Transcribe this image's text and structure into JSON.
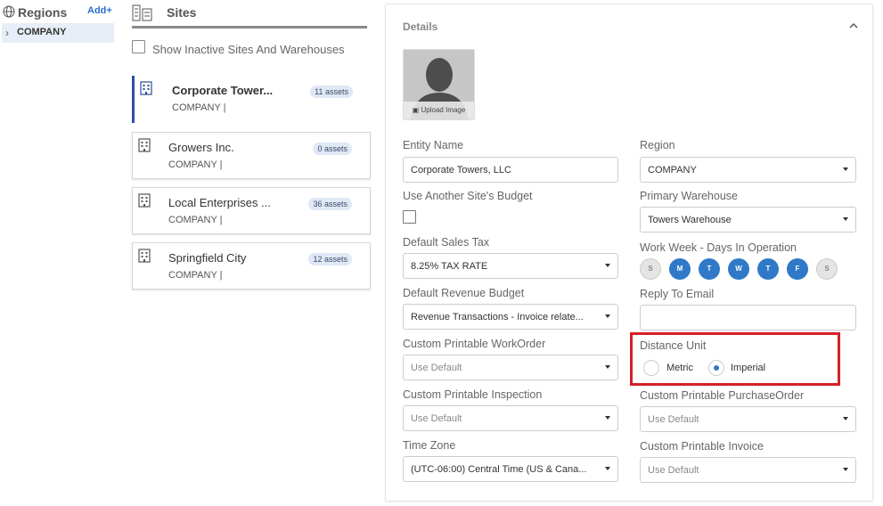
{
  "regions": {
    "title": "Regions",
    "add_label": "Add+",
    "items": [
      {
        "label": "COMPANY",
        "chevron": "›"
      }
    ]
  },
  "sites": {
    "title": "Sites",
    "show_inactive_label": "Show Inactive Sites And Warehouses",
    "cards": [
      {
        "name": "Corporate Tower...",
        "sub": "COMPANY |",
        "badge": "11 assets",
        "selected": true
      },
      {
        "name": "Growers Inc.",
        "sub": "COMPANY |",
        "badge": "0 assets",
        "selected": false
      },
      {
        "name": "Local Enterprises ...",
        "sub": "COMPANY |",
        "badge": "36 assets",
        "selected": false
      },
      {
        "name": "Springfield City",
        "sub": "COMPANY |",
        "badge": "12 assets",
        "selected": false
      }
    ]
  },
  "details": {
    "title": "Details",
    "collapse_icon": "chevron-up",
    "upload_label": "Upload Image",
    "entity_name": {
      "label": "Entity Name",
      "value": "Corporate Towers, LLC"
    },
    "region": {
      "label": "Region",
      "value": "COMPANY"
    },
    "use_another_budget": {
      "label": "Use Another Site's Budget"
    },
    "primary_warehouse": {
      "label": "Primary Warehouse",
      "value": "Towers Warehouse"
    },
    "default_sales_tax": {
      "label": "Default Sales Tax",
      "value": "8.25% TAX RATE"
    },
    "work_week": {
      "label": "Work Week - Days In Operation",
      "days": [
        {
          "letter": "S",
          "on": false
        },
        {
          "letter": "M",
          "on": true
        },
        {
          "letter": "T",
          "on": true
        },
        {
          "letter": "W",
          "on": true
        },
        {
          "letter": "T",
          "on": true
        },
        {
          "letter": "F",
          "on": true
        },
        {
          "letter": "S",
          "on": false
        }
      ]
    },
    "default_revenue_budget": {
      "label": "Default Revenue Budget",
      "value": "Revenue Transactions - Invoice relate..."
    },
    "reply_to_email": {
      "label": "Reply To Email",
      "value": ""
    },
    "custom_workorder": {
      "label": "Custom Printable WorkOrder",
      "value": "Use Default"
    },
    "distance_unit": {
      "label": "Distance Unit",
      "options": [
        "Metric",
        "Imperial"
      ],
      "selected": "Imperial"
    },
    "custom_inspection": {
      "label": "Custom Printable Inspection",
      "value": "Use Default"
    },
    "custom_purchaseorder": {
      "label": "Custom Printable PurchaseOrder",
      "value": "Use Default"
    },
    "time_zone": {
      "label": "Time Zone",
      "value": "(UTC-06:00) Central Time (US & Cana..."
    },
    "custom_invoice": {
      "label": "Custom Printable Invoice",
      "value": "Use Default"
    }
  },
  "colors": {
    "accent": "#2f79c8",
    "highlight": "#d81f26",
    "selected_bar": "#2d4fa8"
  }
}
